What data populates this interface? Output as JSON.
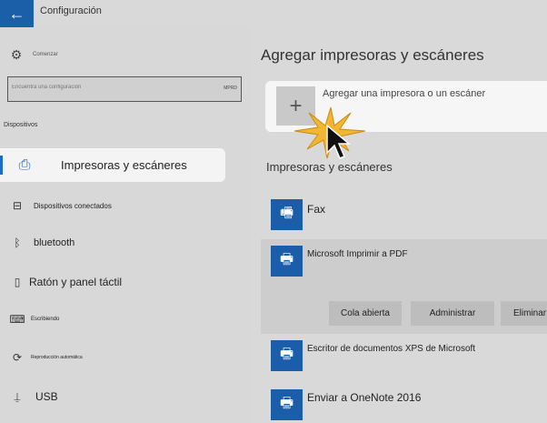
{
  "window": {
    "title": "Configuración",
    "back_glyph": "←"
  },
  "sidebar": {
    "home": {
      "label": "Comenzar",
      "icon": "gear-icon",
      "glyph": "⚙"
    },
    "search": {
      "placeholder": "Encuentra una configuración",
      "button_text": "MPRD"
    },
    "section": "Dispositivos",
    "items": [
      {
        "label": "Impresoras y escáneres",
        "icon": "printer-icon",
        "glyph": "⎙",
        "active": true
      },
      {
        "label": "Dispositivos conectados",
        "icon": "devices-icon",
        "glyph": "⊟"
      },
      {
        "label": "bluetooth",
        "icon": "bluetooth-icon",
        "glyph": "ᛒ"
      },
      {
        "label": "Ratón y panel táctil",
        "icon": "mouse-icon",
        "glyph": "▯"
      },
      {
        "label": "Escribiendo",
        "icon": "keyboard-icon",
        "glyph": "⌨"
      },
      {
        "label": "Reproducción automática",
        "icon": "autoplay-icon",
        "glyph": "⟳"
      },
      {
        "label": "USB",
        "icon": "usb-icon",
        "glyph": "⍊"
      }
    ]
  },
  "main": {
    "title": "Agregar impresoras y escáneres",
    "add": {
      "label": "Agregar una impresora o un escáner",
      "glyph": "+"
    },
    "list_title": "Impresoras y escáneres",
    "printers": [
      {
        "name": "Fax",
        "icon": "fax-icon",
        "glyph": "🖷"
      },
      {
        "name": "Microsoft Imprimir a PDF",
        "icon": "pdf-printer-icon",
        "glyph": "🖶"
      },
      {
        "name": "Escritor de documentos XPS de Microsoft",
        "icon": "xps-printer-icon",
        "glyph": "🖶"
      },
      {
        "name": "Enviar a OneNote 2016",
        "icon": "onenote-printer-icon",
        "glyph": "🖶"
      }
    ],
    "actions": {
      "open_queue": "Cola abierta",
      "manage": "Administrar",
      "remove": "Eliminar"
    }
  },
  "colors": {
    "accent": "#1a6cc4",
    "printer_tile": "#1b5da8",
    "burst": "#f2b632"
  }
}
